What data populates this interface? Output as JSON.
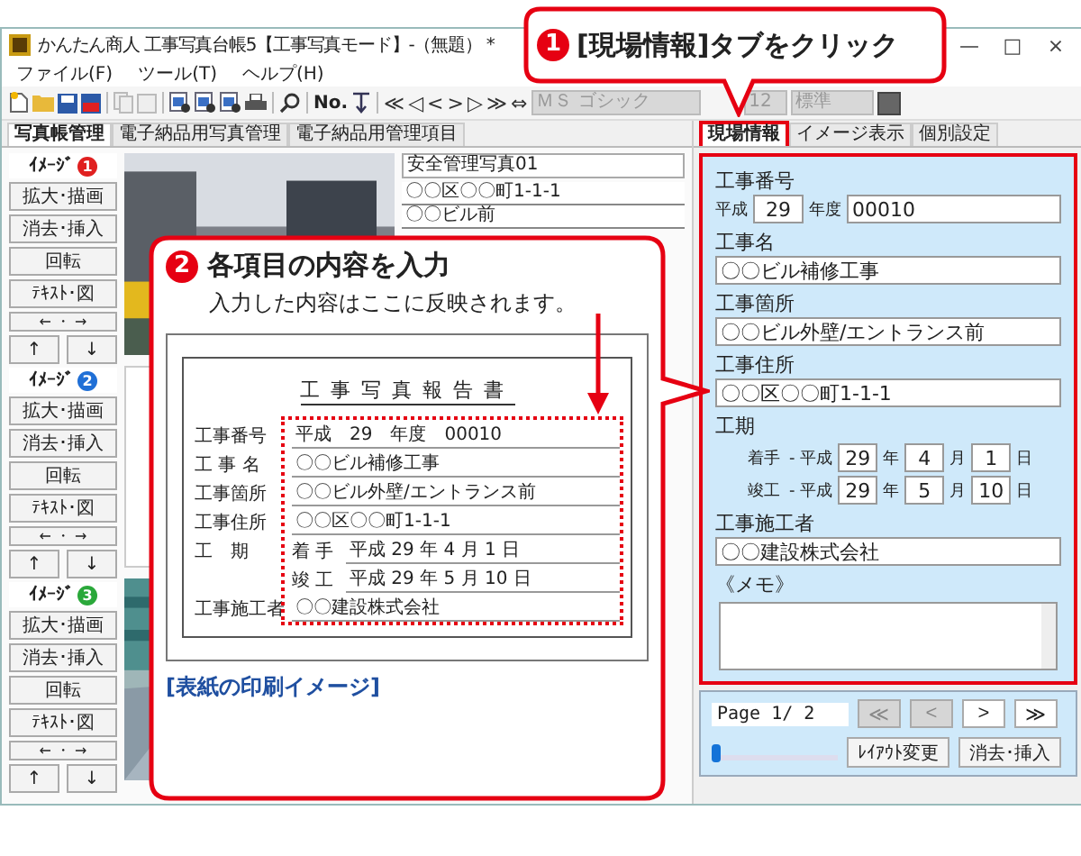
{
  "window": {
    "title": "かんたん商人 工事写真台帳5【工事写真モード】-（無題） *",
    "controls": [
      "—",
      "□",
      "×"
    ]
  },
  "menu": [
    "ファイル(F)",
    "ツール(T)",
    "ヘルプ(H)"
  ],
  "toolbar": {
    "label": "No.",
    "nav": [
      "≪",
      "◁",
      "<",
      ">",
      "▷",
      "≫",
      "⇔"
    ],
    "font": "ＭＳ ゴシック",
    "size": "12",
    "style": "標準",
    "font_disabled": true
  },
  "left_tabs": [
    {
      "label": "写真帳管理",
      "selected": true
    },
    {
      "label": "電子納品用写真管理",
      "selected": false
    },
    {
      "label": "電子納品用管理項目",
      "selected": false
    }
  ],
  "image_groups": [
    {
      "label": "ｲﾒｰｼﾞ",
      "number": "1",
      "color": "#e02020",
      "buttons": [
        "拡大･描画",
        "消去･挿入",
        "回転",
        "ﾃｷｽﾄ･図"
      ],
      "shift": "← ・ →",
      "arrows": [
        "↑",
        "↓"
      ]
    },
    {
      "label": "ｲﾒｰｼﾞ",
      "number": "2",
      "color": "#1f6fd6",
      "buttons": [
        "拡大･描画",
        "消去･挿入",
        "回転",
        "ﾃｷｽﾄ･図"
      ],
      "shift": "← ・ →",
      "arrows": [
        "↑",
        "↓"
      ]
    },
    {
      "label": "ｲﾒｰｼﾞ",
      "number": "3",
      "color": "#2aa83a",
      "buttons": [
        "拡大･描画",
        "消去･挿入",
        "回転",
        "ﾃｷｽﾄ･図"
      ],
      "shift": "← ・ →",
      "arrows": [
        "↑",
        "↓"
      ]
    }
  ],
  "photos": [
    {
      "kind": "picture"
    },
    {
      "kind": "blank"
    },
    {
      "kind": "picture"
    }
  ],
  "captions": [
    "安全管理写真01",
    "〇〇区〇〇町1-1-1",
    "〇〇ビル前"
  ],
  "right_tabs": [
    {
      "label": "現場情報",
      "selected": true
    },
    {
      "label": "イメージ表示",
      "selected": false
    },
    {
      "label": "個別設定",
      "selected": false
    }
  ],
  "site_info": {
    "number": {
      "label": "工事番号",
      "era": "平成",
      "year": "29",
      "year_unit": "年度",
      "value": "00010"
    },
    "fields": [
      {
        "label": "工事名",
        "value": "〇〇ビル補修工事"
      },
      {
        "label": "工事箇所",
        "value": "〇〇ビル外壁/エントランス前"
      },
      {
        "label": "工事住所",
        "value": "〇〇区〇〇町1-1-1"
      }
    ],
    "period": {
      "label": "工期",
      "rows": [
        {
          "label": "着手",
          "era": "- 平成",
          "year": "29",
          "y_unit": "年",
          "month": "4",
          "m_unit": "月",
          "day": "1",
          "d_unit": "日"
        },
        {
          "label": "竣工",
          "era": "- 平成",
          "year": "29",
          "y_unit": "年",
          "month": "5",
          "m_unit": "月",
          "day": "10",
          "d_unit": "日"
        }
      ]
    },
    "builder": {
      "label": "工事施工者",
      "value": "〇〇建設株式会社"
    },
    "memo": {
      "label": "《メモ》"
    }
  },
  "pager": {
    "page": "Page 1/ 2",
    "buttons": [
      {
        "label": "≪",
        "disabled": true
      },
      {
        "label": "<",
        "disabled": true
      },
      {
        "label": ">",
        "disabled": false
      },
      {
        "label": "≫",
        "disabled": false
      }
    ],
    "level": 0,
    "actions": [
      "ﾚｲｱｳﾄ変更",
      "消去･挿入"
    ]
  },
  "callout_1": {
    "number": "1",
    "text": "[現場情報]タブをクリック"
  },
  "callout_2": {
    "number": "2",
    "title": "各項目の内容を入力",
    "subtitle": "入力した内容はここに反映されます。",
    "caption": "[表紙の印刷イメージ]",
    "cover": {
      "title": "工事写真報告書",
      "rows": [
        {
          "kind": "line",
          "label": "工事番号",
          "value": "平成　29　年度　00010"
        },
        {
          "kind": "line",
          "label": "工 事 名",
          "value": "〇〇ビル補修工事"
        },
        {
          "kind": "line",
          "label": "工事箇所",
          "value": "〇〇ビル外壁/エントランス前"
        },
        {
          "kind": "line",
          "label": "工事住所",
          "value": "〇〇区〇〇町1-1-1"
        },
        {
          "kind": "period",
          "label": "工　期",
          "entries": [
            {
              "label": "着 手",
              "value": "平成 29 年 4 月 1 日"
            },
            {
              "label": "竣 工",
              "value": "平成 29 年 5 月 10 日"
            }
          ]
        },
        {
          "kind": "line",
          "label": "工事施工者",
          "value": "〇〇建設株式会社"
        }
      ]
    }
  }
}
